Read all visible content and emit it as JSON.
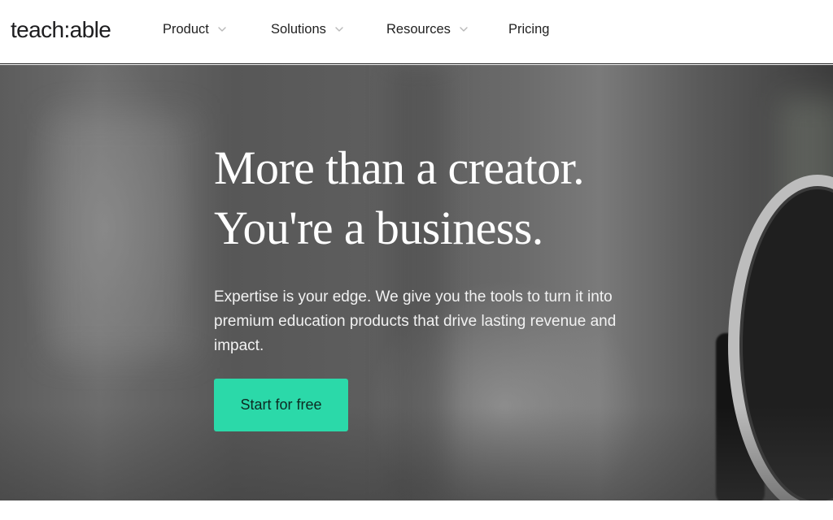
{
  "header": {
    "logo_text": "teach:able",
    "nav": [
      {
        "label": "Product",
        "has_dropdown": true
      },
      {
        "label": "Solutions",
        "has_dropdown": true
      },
      {
        "label": "Resources",
        "has_dropdown": true
      },
      {
        "label": "Pricing",
        "has_dropdown": false
      }
    ],
    "icons": {
      "dropdown": "chevron-down-icon"
    }
  },
  "hero": {
    "headline_line1": "More than a creator.",
    "headline_line2": "You're a business.",
    "subtext": "Expertise is your edge. We give you the tools to turn it into premium education products that drive lasting revenue and impact.",
    "cta_label": "Start for free"
  },
  "colors": {
    "cta_background": "#2bd9a9",
    "headline_text": "#ffffff",
    "nav_text": "#1f1f1f"
  }
}
